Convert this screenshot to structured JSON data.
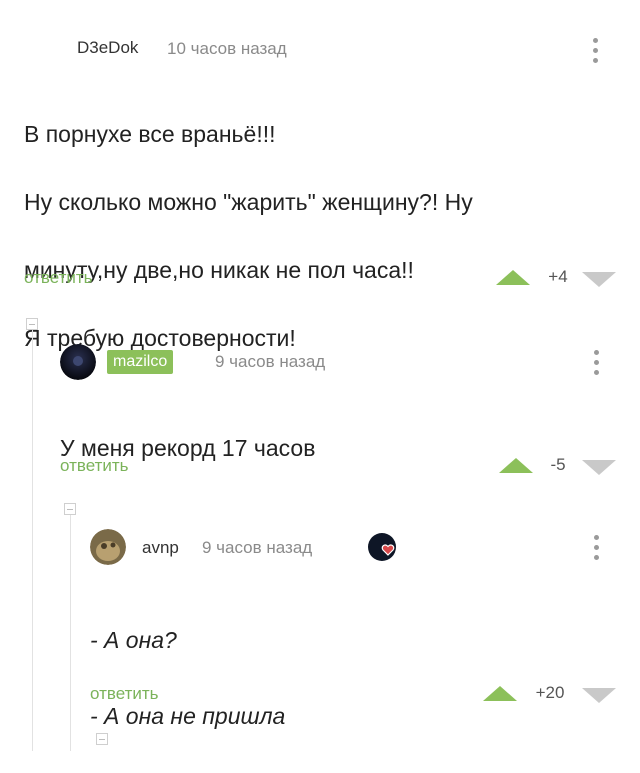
{
  "comments": [
    {
      "author": "D3eDok",
      "time": "10 часов назад",
      "text_lines": [
        "В порнухе все враньё!!!",
        "Ну сколько можно \"жарить\" женщину?! Ну",
        "минуту,ну две,но никак не пол часа!!",
        "Я требую достоверности!"
      ],
      "reply_label": "ответить",
      "score": "+4"
    },
    {
      "author": "mazilco",
      "time": "9 часов назад",
      "text_lines": [
        "У меня рекорд 17 часов"
      ],
      "reply_label": "ответить",
      "score": "-5"
    },
    {
      "author": "avnp",
      "time": "9 часов назад",
      "text_lines": [
        "- А она?",
        "- А она не пришла"
      ],
      "reply_label": "ответить",
      "score": "+20"
    }
  ],
  "colors": {
    "accent_green": "#8cc05a",
    "reply_green": "#7bb35a",
    "vote_down_gray": "#c9c9c9"
  },
  "icons": {
    "menu": "vertical-dots-icon",
    "upvote": "triangle-up-icon",
    "downvote": "triangle-down-icon",
    "collapse": "collapse-minus-icon"
  }
}
